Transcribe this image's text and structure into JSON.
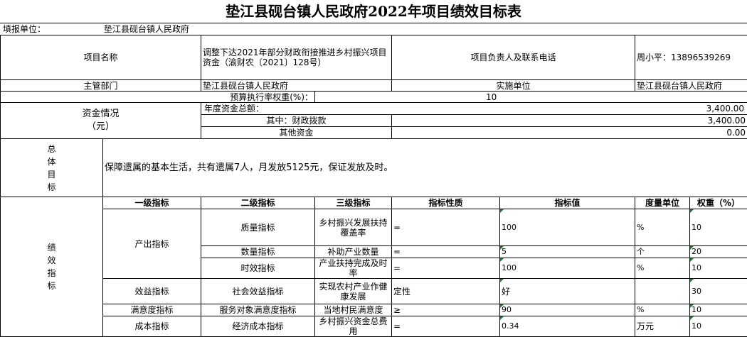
{
  "title": "垫江县砚台镇人民政府2022年项目绩效目标表",
  "unit": {
    "label": "填报单位：",
    "value": "垫江县砚台镇人民政府"
  },
  "project": {
    "name_label": "项目名称",
    "name": "调整下达2021年部分财政衔接推进乡村振兴项目资金（渝财农〔2021〕128号）",
    "contact_label": "项目负责人及联系电话",
    "contact": "周小平：13896539269"
  },
  "dept": {
    "label": "主管部门",
    "value": "垫江县砚台镇人民政府",
    "impl_label": "实施单位",
    "impl_value": "垫江县砚台镇人民政府"
  },
  "budget": {
    "label": "预算执行率权重(%)：",
    "value": "10"
  },
  "funds": {
    "label": "资金情况\n（元）",
    "rows": [
      {
        "label": "年度资金总额：",
        "value": "3,400.00"
      },
      {
        "label": "其中：财政拨款",
        "value": "3,400.00"
      },
      {
        "label": "其他资金",
        "value": "0.00"
      }
    ]
  },
  "goal": {
    "label": "总\n体\n目\n标",
    "text": "保障遗属的基本生活，共有遗属7人，月发放5125元，保证发放及时。"
  },
  "perf": {
    "label": "绩\n效\n指\n标",
    "headers": [
      "一级指标",
      "二级指标",
      "三级指标",
      "指标性质",
      "指标值",
      "度量单位",
      "权重（%）"
    ],
    "l1": {
      "output": "产出指标",
      "benefit": "效益指标",
      "satisfaction": "满意度指标",
      "cost": "成本指标"
    },
    "rows": [
      {
        "l2": "质量指标",
        "l3": "乡村振兴发展扶持覆盖率",
        "nature": "=",
        "value": "100",
        "unit": "%",
        "weight": "10"
      },
      {
        "l2": "数量指标",
        "l3": "补助产业数量",
        "nature": "=",
        "value": "5",
        "unit": "个",
        "weight": "20"
      },
      {
        "l2": "时效指标",
        "l3": "产业扶持完成及时率",
        "nature": "=",
        "value": "100",
        "unit": "%",
        "weight": "10"
      },
      {
        "l2": "社会效益指标",
        "l3": "实现农村产业作健康发展",
        "nature": "定性",
        "value": "好",
        "unit": "",
        "weight": "30"
      },
      {
        "l2": "服务对象满意度指标",
        "l3": "当地村民满意度",
        "nature": "≥",
        "value": "90",
        "unit": "%",
        "weight": "10"
      },
      {
        "l2": "经济成本指标",
        "l3": "乡村振兴资金总费用",
        "nature": "=",
        "value": "0.34",
        "unit": "万元",
        "weight": "10"
      }
    ]
  }
}
